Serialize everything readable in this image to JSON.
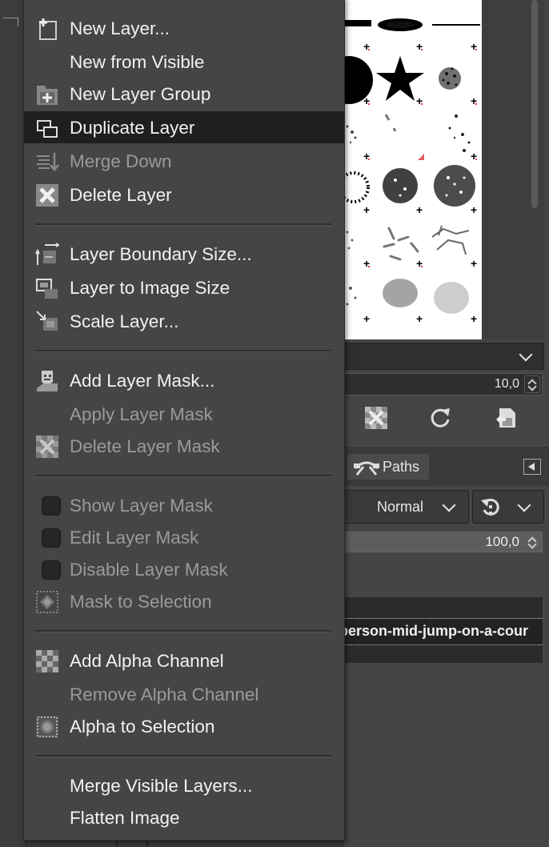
{
  "background": {
    "preset_select": {
      "chevron_icon": "chevron-down-icon"
    },
    "spacing_value": "10,0",
    "tool_icons": [
      "delete-brush-icon",
      "refresh-icon",
      "open-as-image-icon"
    ],
    "tabs": {
      "paths_label": "Paths",
      "tab_menu_icon": "triangle-left-icon"
    },
    "mode": {
      "label": "Normal"
    },
    "opacity_value": "100,0",
    "layer_name": "person-mid-jump-on-a-cour"
  },
  "menu": {
    "items": [
      {
        "label": "New Layer...",
        "icon": "new-layer-icon",
        "disabled": false
      },
      {
        "label": "New from Visible",
        "icon": "",
        "disabled": false
      },
      {
        "label": "New Layer Group",
        "icon": "new-layer-group-icon",
        "disabled": false
      },
      {
        "label": "Duplicate Layer",
        "icon": "duplicate-layer-icon",
        "disabled": false,
        "highlighted": true
      },
      {
        "label": "Merge Down",
        "icon": "merge-down-icon",
        "disabled": true
      },
      {
        "label": "Delete Layer",
        "icon": "delete-layer-icon",
        "disabled": false
      },
      {
        "label": "Layer Boundary Size...",
        "icon": "layer-boundary-size-icon",
        "disabled": false
      },
      {
        "label": "Layer to Image Size",
        "icon": "layer-to-image-size-icon",
        "disabled": false
      },
      {
        "label": "Scale Layer...",
        "icon": "scale-layer-icon",
        "disabled": false
      },
      {
        "label": "Add Layer Mask...",
        "icon": "add-layer-mask-icon",
        "disabled": false
      },
      {
        "label": "Apply Layer Mask",
        "icon": "",
        "disabled": true
      },
      {
        "label": "Delete Layer Mask",
        "icon": "delete-layer-mask-icon",
        "disabled": true
      },
      {
        "label": "Show Layer Mask",
        "icon": "checkbox",
        "disabled": true
      },
      {
        "label": "Edit Layer Mask",
        "icon": "checkbox",
        "disabled": true
      },
      {
        "label": "Disable Layer Mask",
        "icon": "checkbox",
        "disabled": true
      },
      {
        "label": "Mask to Selection",
        "icon": "mask-to-selection-icon",
        "disabled": true
      },
      {
        "label": "Add Alpha Channel",
        "icon": "add-alpha-channel-icon",
        "disabled": false
      },
      {
        "label": "Remove Alpha Channel",
        "icon": "",
        "disabled": true
      },
      {
        "label": "Alpha to Selection",
        "icon": "alpha-to-selection-icon",
        "disabled": false
      },
      {
        "label": "Merge Visible Layers...",
        "icon": "",
        "disabled": false
      },
      {
        "label": "Flatten Image",
        "icon": "",
        "disabled": false
      }
    ]
  }
}
